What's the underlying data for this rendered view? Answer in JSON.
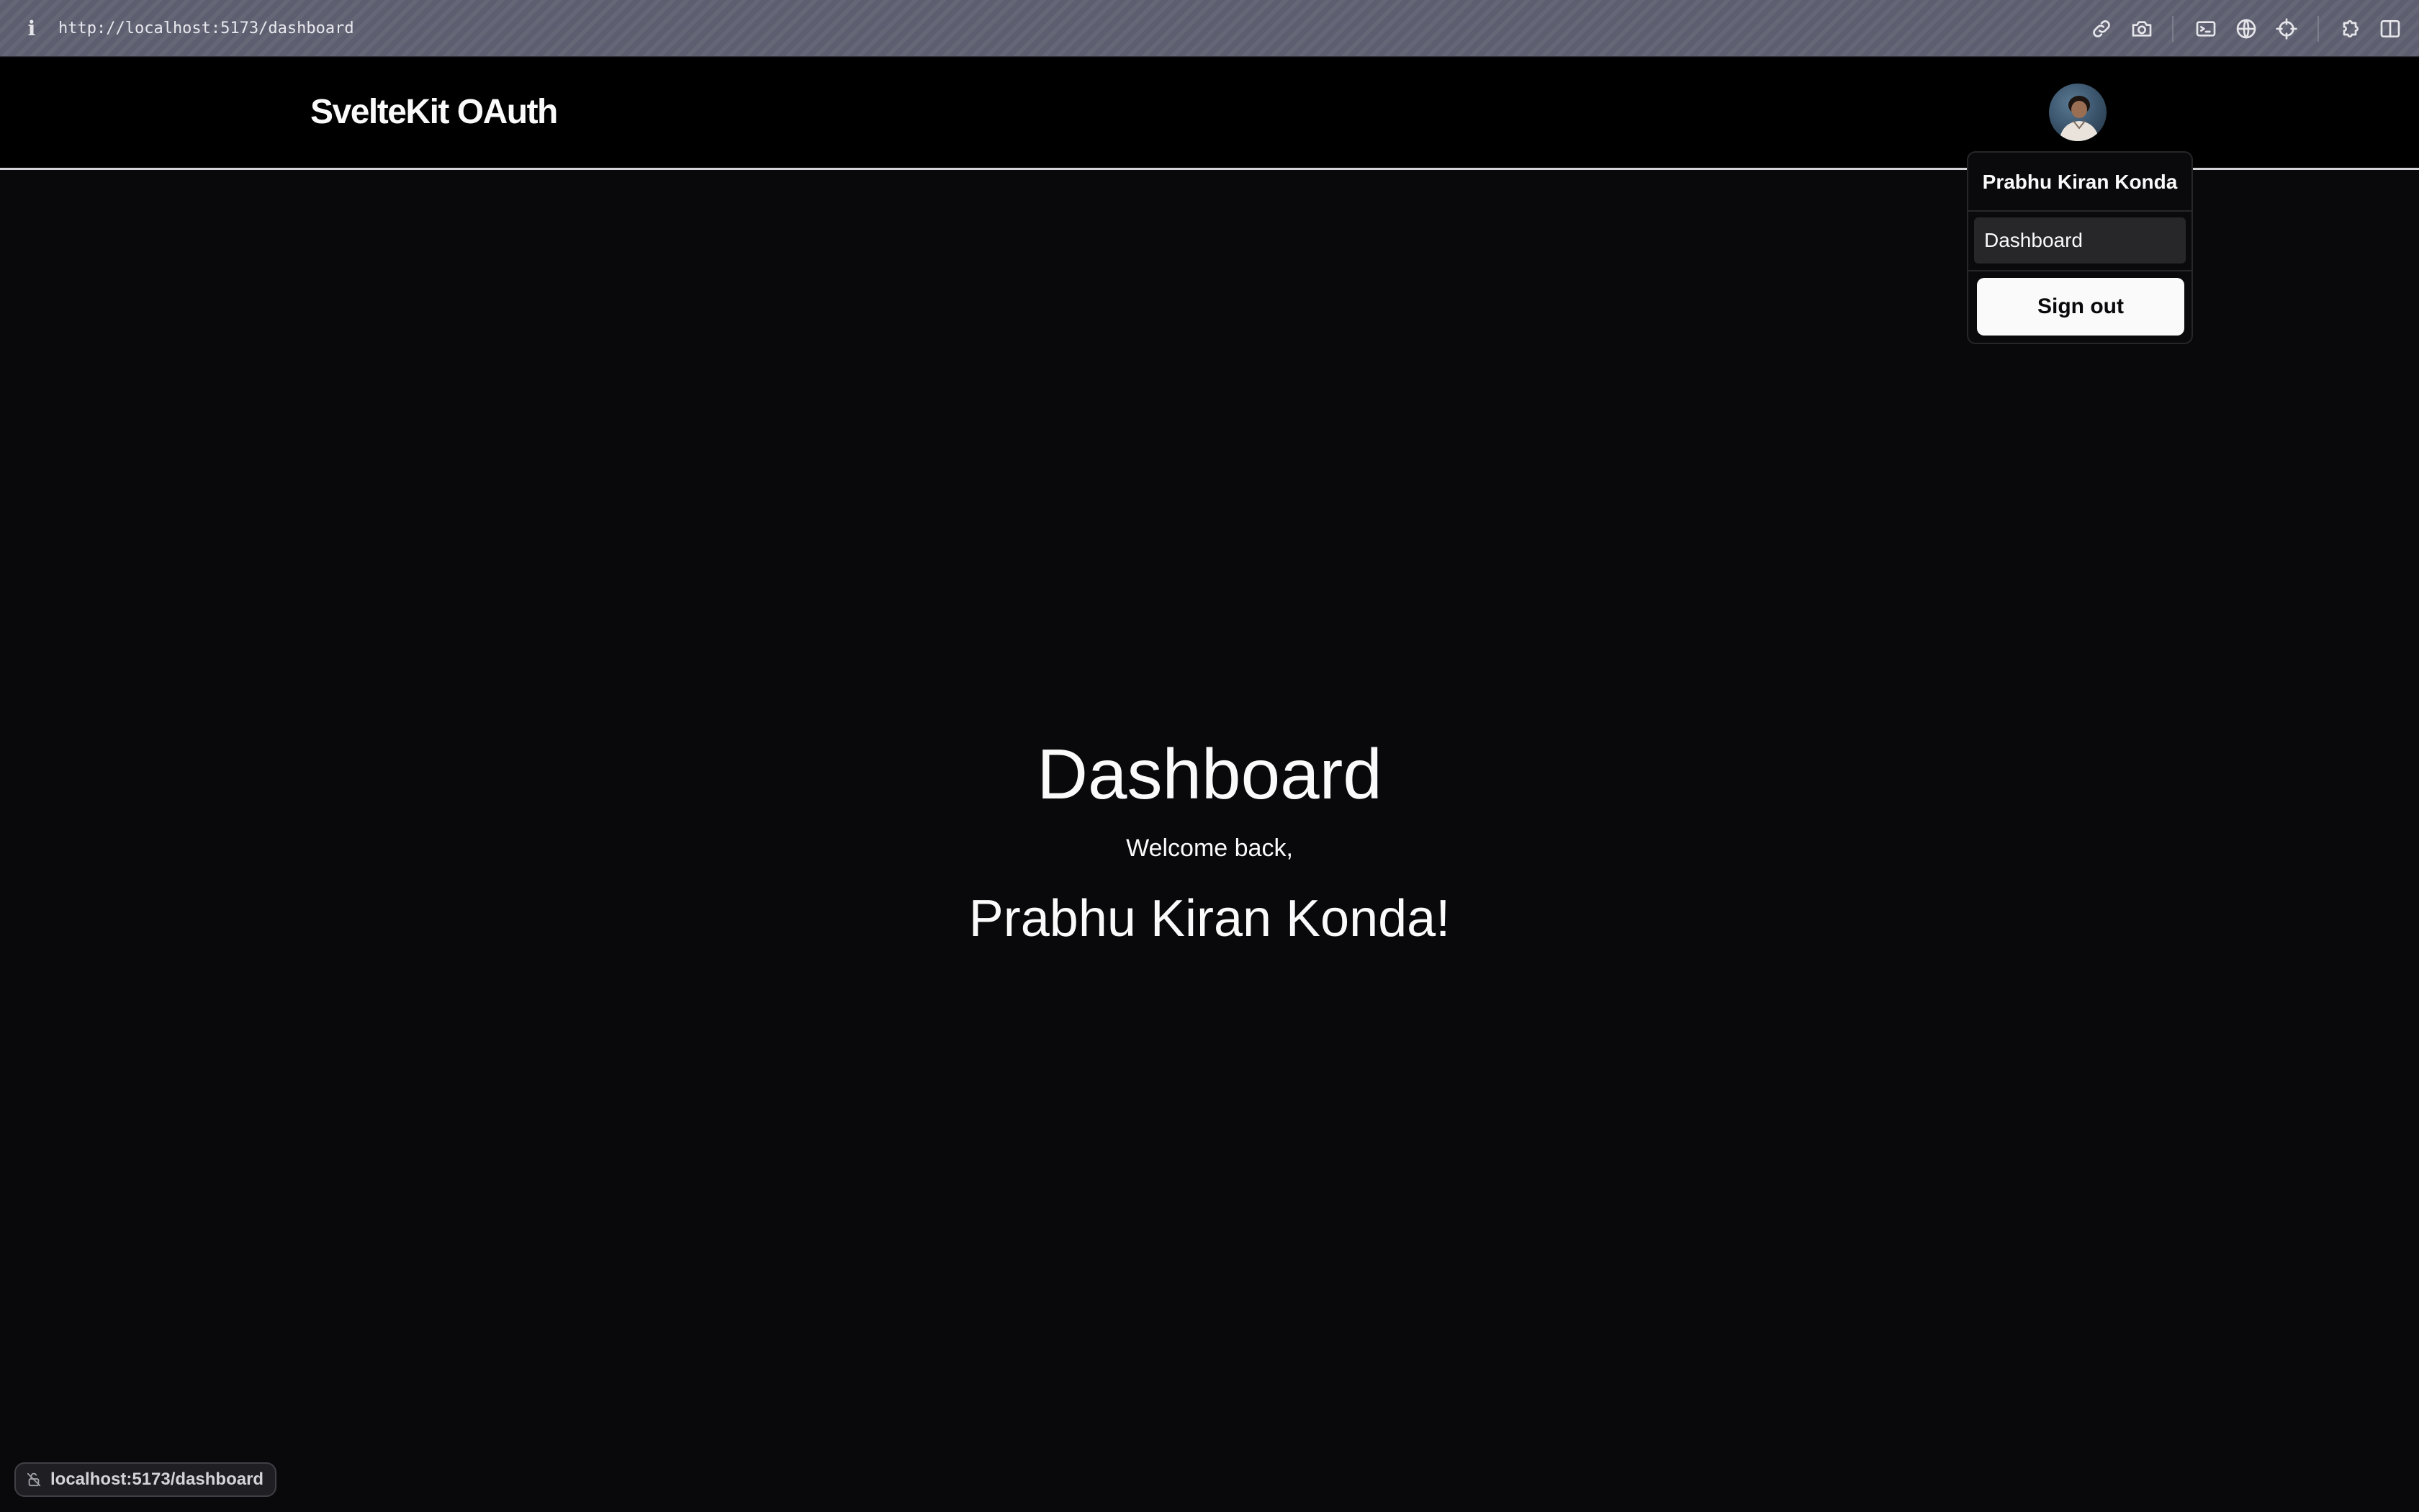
{
  "browser": {
    "url": "http://localhost:5173/dashboard",
    "info_glyph": "i",
    "toolbar_icons": [
      "link-icon",
      "camera-icon",
      "terminal-icon",
      "globe-icon",
      "crosshair-icon",
      "extensions-icon",
      "split-view-icon"
    ]
  },
  "header": {
    "brand": "SvelteKit OAuth",
    "avatar_alt": "User avatar"
  },
  "user_menu": {
    "name": "Prabhu Kiran Konda",
    "items": [
      {
        "label": "Dashboard"
      }
    ],
    "sign_out_label": "Sign out"
  },
  "main": {
    "title": "Dashboard",
    "welcome": "Welcome back,",
    "user_name": "Prabhu Kiran Konda!"
  },
  "status_bar": {
    "link_preview": "localhost:5173/dashboard"
  },
  "colors": {
    "page_background": "#09090b",
    "header_background": "#000000",
    "menu_item_highlight": "#27272a",
    "button_background": "#fafafa"
  }
}
